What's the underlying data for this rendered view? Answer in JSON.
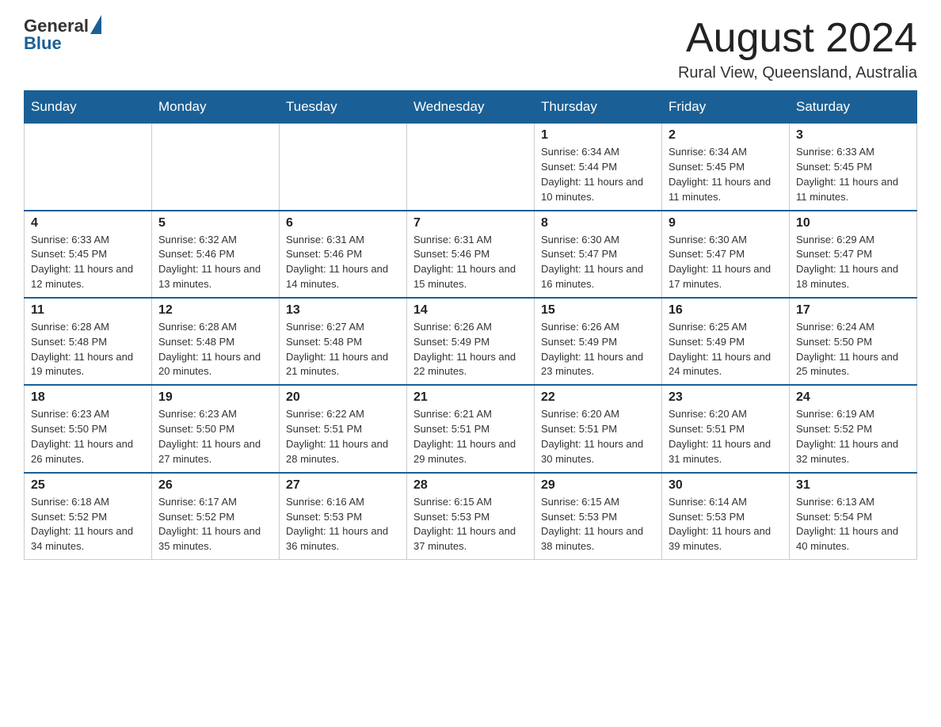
{
  "logo": {
    "text_general": "General",
    "text_blue": "Blue"
  },
  "title": "August 2024",
  "subtitle": "Rural View, Queensland, Australia",
  "days_of_week": [
    "Sunday",
    "Monday",
    "Tuesday",
    "Wednesday",
    "Thursday",
    "Friday",
    "Saturday"
  ],
  "weeks": [
    [
      {
        "day": "",
        "info": ""
      },
      {
        "day": "",
        "info": ""
      },
      {
        "day": "",
        "info": ""
      },
      {
        "day": "",
        "info": ""
      },
      {
        "day": "1",
        "info": "Sunrise: 6:34 AM\nSunset: 5:44 PM\nDaylight: 11 hours and 10 minutes."
      },
      {
        "day": "2",
        "info": "Sunrise: 6:34 AM\nSunset: 5:45 PM\nDaylight: 11 hours and 11 minutes."
      },
      {
        "day": "3",
        "info": "Sunrise: 6:33 AM\nSunset: 5:45 PM\nDaylight: 11 hours and 11 minutes."
      }
    ],
    [
      {
        "day": "4",
        "info": "Sunrise: 6:33 AM\nSunset: 5:45 PM\nDaylight: 11 hours and 12 minutes."
      },
      {
        "day": "5",
        "info": "Sunrise: 6:32 AM\nSunset: 5:46 PM\nDaylight: 11 hours and 13 minutes."
      },
      {
        "day": "6",
        "info": "Sunrise: 6:31 AM\nSunset: 5:46 PM\nDaylight: 11 hours and 14 minutes."
      },
      {
        "day": "7",
        "info": "Sunrise: 6:31 AM\nSunset: 5:46 PM\nDaylight: 11 hours and 15 minutes."
      },
      {
        "day": "8",
        "info": "Sunrise: 6:30 AM\nSunset: 5:47 PM\nDaylight: 11 hours and 16 minutes."
      },
      {
        "day": "9",
        "info": "Sunrise: 6:30 AM\nSunset: 5:47 PM\nDaylight: 11 hours and 17 minutes."
      },
      {
        "day": "10",
        "info": "Sunrise: 6:29 AM\nSunset: 5:47 PM\nDaylight: 11 hours and 18 minutes."
      }
    ],
    [
      {
        "day": "11",
        "info": "Sunrise: 6:28 AM\nSunset: 5:48 PM\nDaylight: 11 hours and 19 minutes."
      },
      {
        "day": "12",
        "info": "Sunrise: 6:28 AM\nSunset: 5:48 PM\nDaylight: 11 hours and 20 minutes."
      },
      {
        "day": "13",
        "info": "Sunrise: 6:27 AM\nSunset: 5:48 PM\nDaylight: 11 hours and 21 minutes."
      },
      {
        "day": "14",
        "info": "Sunrise: 6:26 AM\nSunset: 5:49 PM\nDaylight: 11 hours and 22 minutes."
      },
      {
        "day": "15",
        "info": "Sunrise: 6:26 AM\nSunset: 5:49 PM\nDaylight: 11 hours and 23 minutes."
      },
      {
        "day": "16",
        "info": "Sunrise: 6:25 AM\nSunset: 5:49 PM\nDaylight: 11 hours and 24 minutes."
      },
      {
        "day": "17",
        "info": "Sunrise: 6:24 AM\nSunset: 5:50 PM\nDaylight: 11 hours and 25 minutes."
      }
    ],
    [
      {
        "day": "18",
        "info": "Sunrise: 6:23 AM\nSunset: 5:50 PM\nDaylight: 11 hours and 26 minutes."
      },
      {
        "day": "19",
        "info": "Sunrise: 6:23 AM\nSunset: 5:50 PM\nDaylight: 11 hours and 27 minutes."
      },
      {
        "day": "20",
        "info": "Sunrise: 6:22 AM\nSunset: 5:51 PM\nDaylight: 11 hours and 28 minutes."
      },
      {
        "day": "21",
        "info": "Sunrise: 6:21 AM\nSunset: 5:51 PM\nDaylight: 11 hours and 29 minutes."
      },
      {
        "day": "22",
        "info": "Sunrise: 6:20 AM\nSunset: 5:51 PM\nDaylight: 11 hours and 30 minutes."
      },
      {
        "day": "23",
        "info": "Sunrise: 6:20 AM\nSunset: 5:51 PM\nDaylight: 11 hours and 31 minutes."
      },
      {
        "day": "24",
        "info": "Sunrise: 6:19 AM\nSunset: 5:52 PM\nDaylight: 11 hours and 32 minutes."
      }
    ],
    [
      {
        "day": "25",
        "info": "Sunrise: 6:18 AM\nSunset: 5:52 PM\nDaylight: 11 hours and 34 minutes."
      },
      {
        "day": "26",
        "info": "Sunrise: 6:17 AM\nSunset: 5:52 PM\nDaylight: 11 hours and 35 minutes."
      },
      {
        "day": "27",
        "info": "Sunrise: 6:16 AM\nSunset: 5:53 PM\nDaylight: 11 hours and 36 minutes."
      },
      {
        "day": "28",
        "info": "Sunrise: 6:15 AM\nSunset: 5:53 PM\nDaylight: 11 hours and 37 minutes."
      },
      {
        "day": "29",
        "info": "Sunrise: 6:15 AM\nSunset: 5:53 PM\nDaylight: 11 hours and 38 minutes."
      },
      {
        "day": "30",
        "info": "Sunrise: 6:14 AM\nSunset: 5:53 PM\nDaylight: 11 hours and 39 minutes."
      },
      {
        "day": "31",
        "info": "Sunrise: 6:13 AM\nSunset: 5:54 PM\nDaylight: 11 hours and 40 minutes."
      }
    ]
  ]
}
